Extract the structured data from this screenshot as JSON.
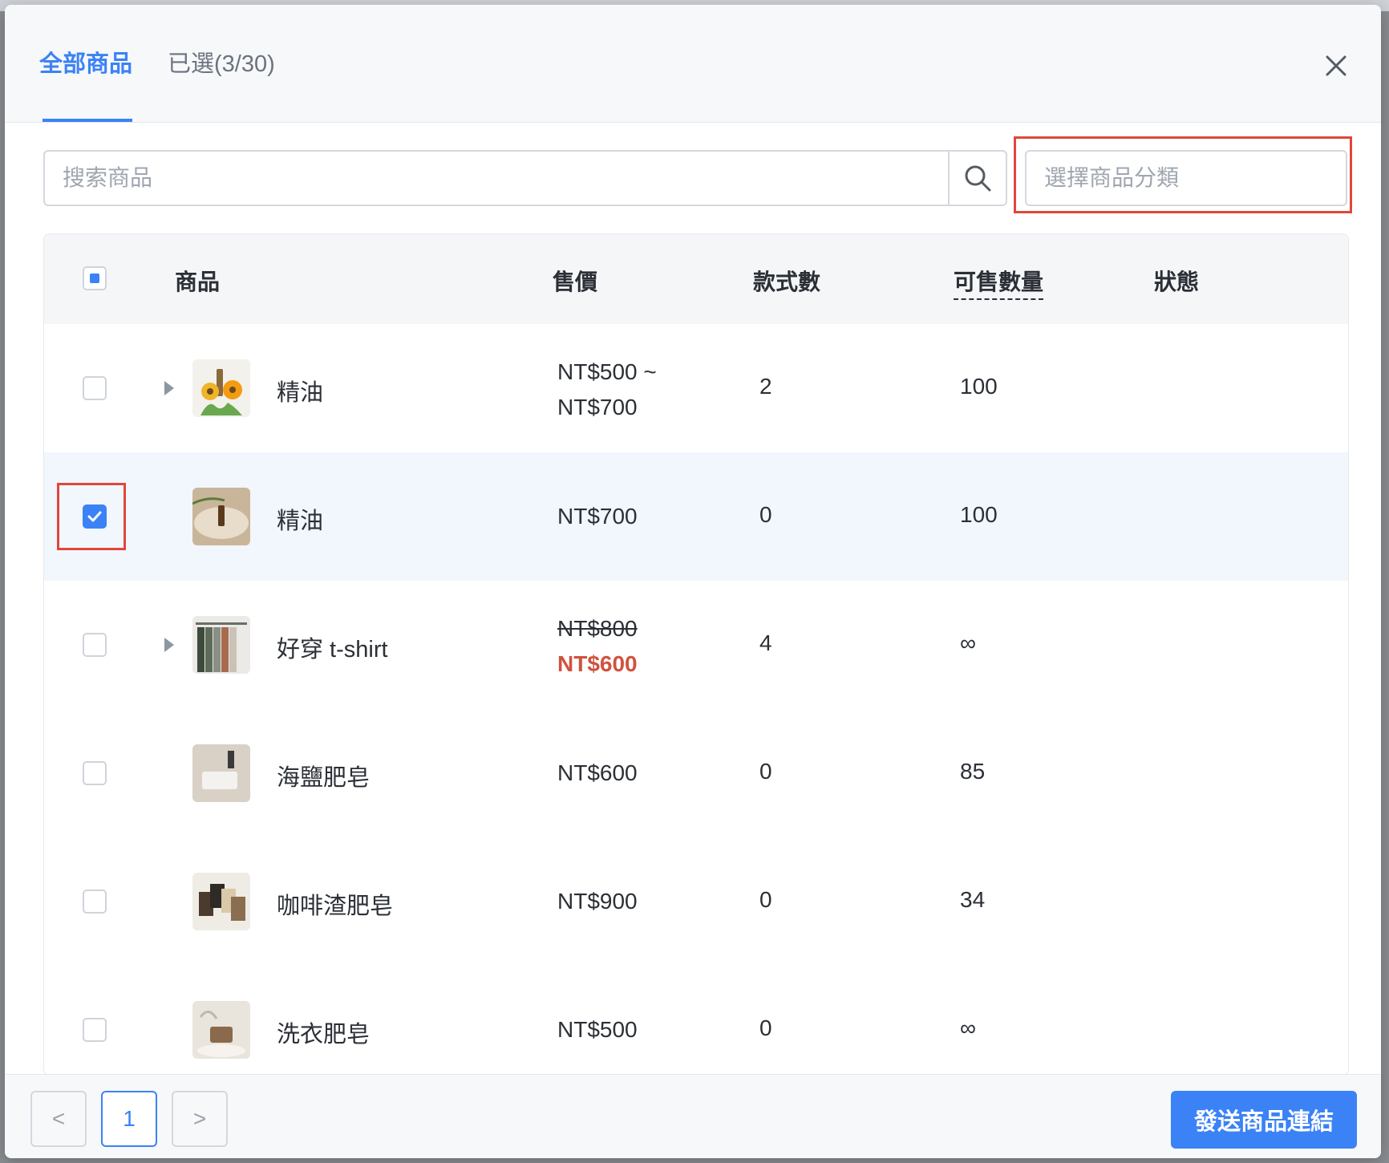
{
  "tabs": {
    "all": "全部商品",
    "selected": "已選(3/30)"
  },
  "search": {
    "placeholder": "搜索商品",
    "value": ""
  },
  "category": {
    "placeholder": "選擇商品分類"
  },
  "table": {
    "headers": {
      "product": "商品",
      "price": "售價",
      "variants": "款式數",
      "available": "可售數量",
      "status": "狀態"
    },
    "rows": [
      {
        "name": "精油",
        "price_line1": "NT$500 ~",
        "price_line2": "NT$700",
        "variants": "2",
        "qty": "100",
        "expandable": true,
        "checked": false
      },
      {
        "name": "精油",
        "price": "NT$700",
        "variants": "0",
        "qty": "100",
        "expandable": false,
        "checked": true
      },
      {
        "name": "好穿 t-shirt",
        "price_original": "NT$800",
        "price_sale": "NT$600",
        "variants": "4",
        "qty": "∞",
        "expandable": true,
        "checked": false
      },
      {
        "name": "海鹽肥皂",
        "price": "NT$600",
        "variants": "0",
        "qty": "85",
        "expandable": false,
        "checked": false
      },
      {
        "name": "咖啡渣肥皂",
        "price": "NT$900",
        "variants": "0",
        "qty": "34",
        "expandable": false,
        "checked": false
      },
      {
        "name": "洗衣肥皂",
        "price": "NT$500",
        "variants": "0",
        "qty": "∞",
        "expandable": false,
        "checked": false
      }
    ]
  },
  "pagination": {
    "prev": "<",
    "current": "1",
    "next": ">"
  },
  "send_button": "發送商品連結",
  "colors": {
    "accent": "#3b82f6",
    "sale": "#d0523f",
    "highlight": "#e0473a"
  }
}
